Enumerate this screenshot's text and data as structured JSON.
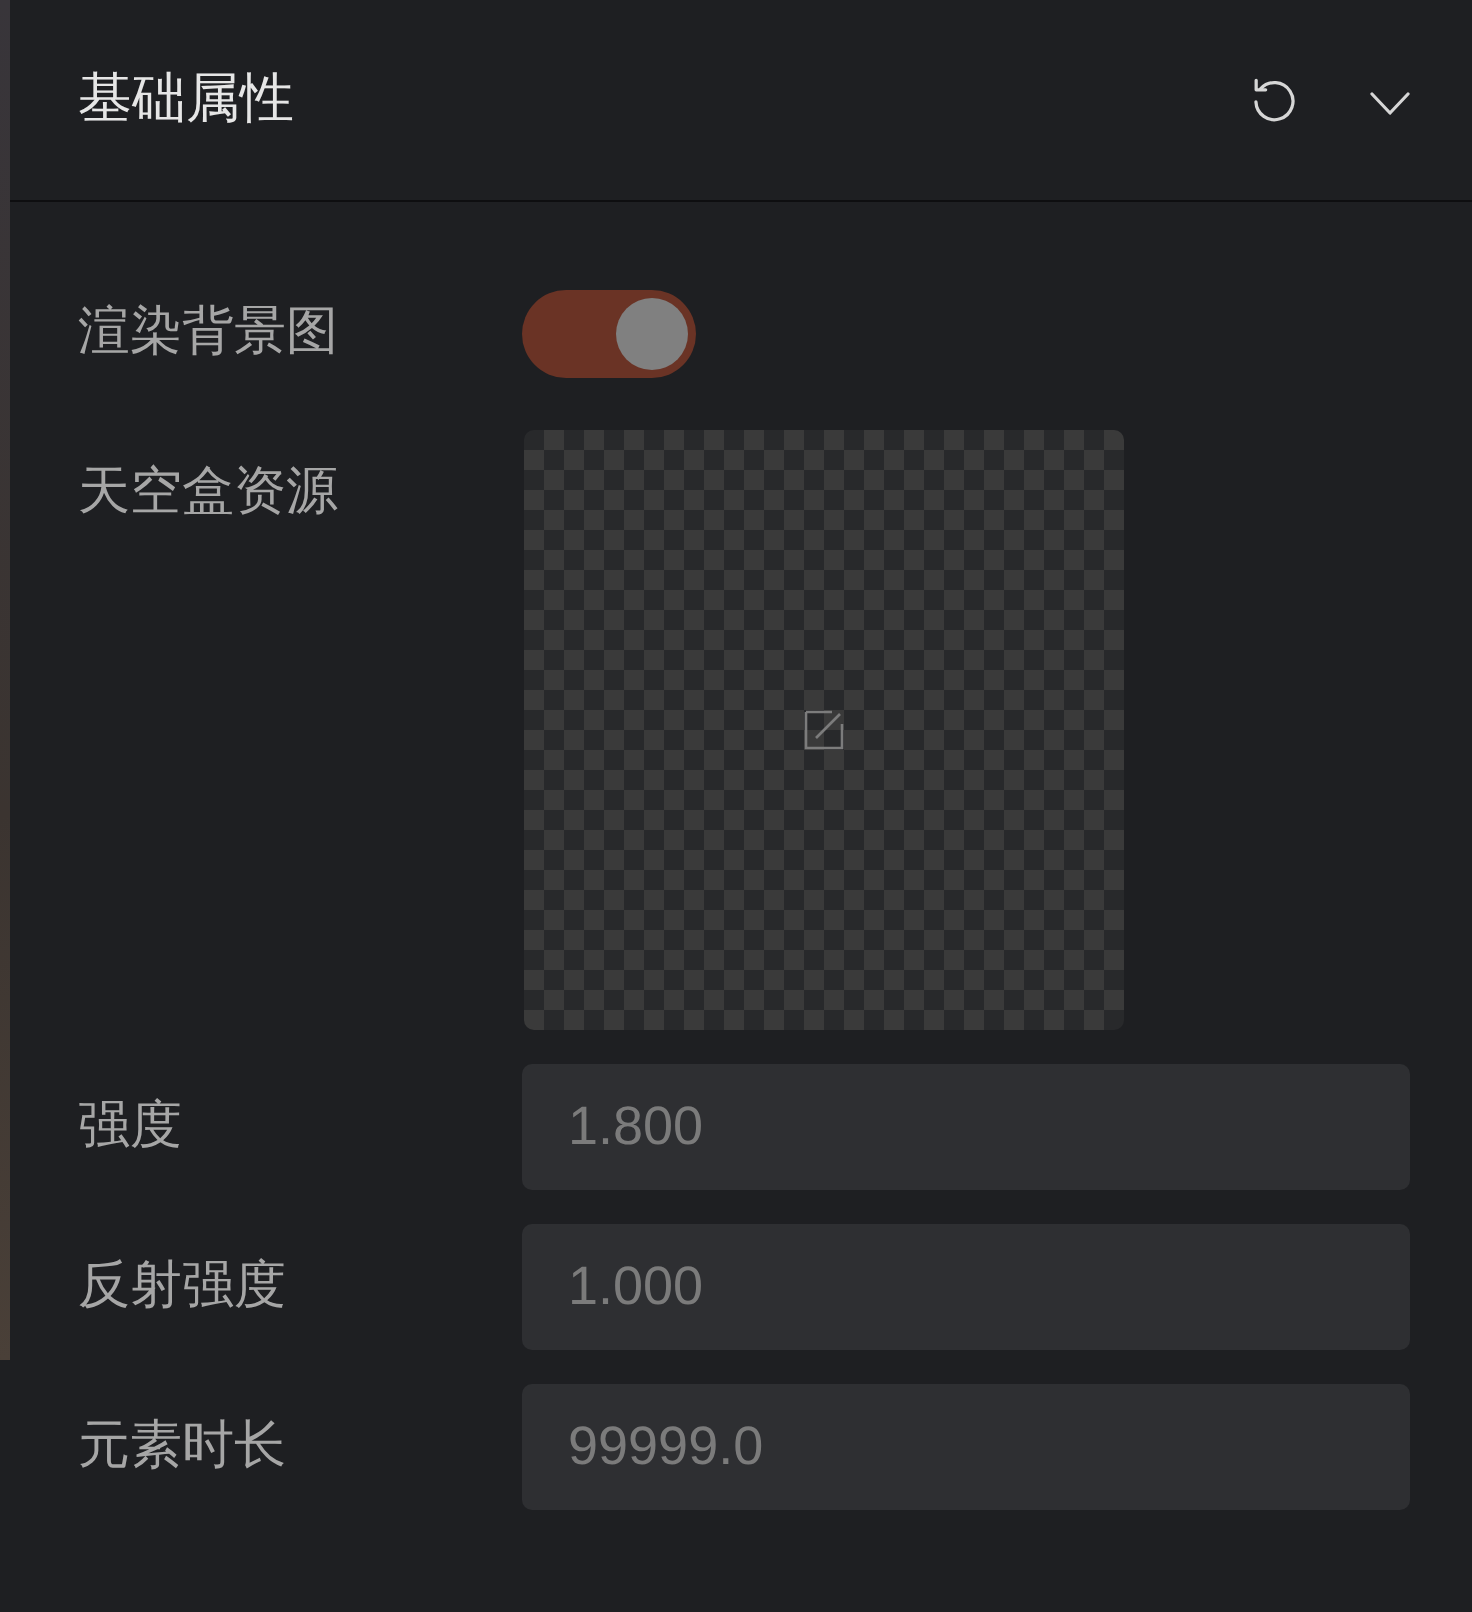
{
  "panel": {
    "title": "基础属性",
    "expanded": true
  },
  "fields": [
    {
      "kind": "toggle",
      "label": "渲染背景图",
      "on": true
    },
    {
      "kind": "image",
      "label": "天空盒资源"
    },
    {
      "kind": "number",
      "label": "强度",
      "value": "1.800"
    },
    {
      "kind": "number",
      "label": "反射强度",
      "value": "1.000"
    },
    {
      "kind": "number",
      "label": "元素时长",
      "value": "99999.0"
    }
  ]
}
